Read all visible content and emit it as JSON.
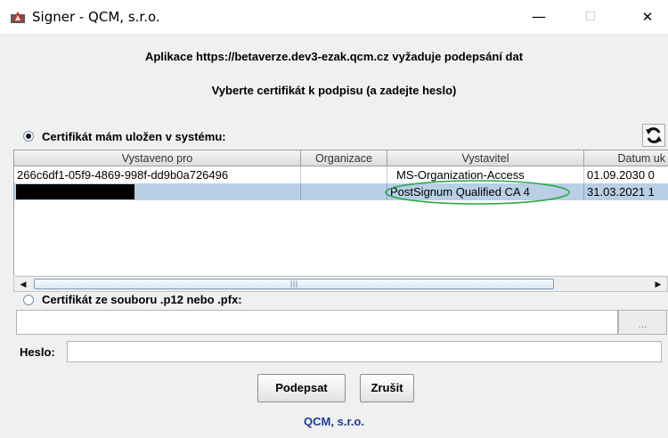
{
  "window": {
    "title": "Signer - QCM, s.r.o.",
    "minimize_glyph": "—",
    "maximize_glyph": "☐",
    "close_glyph": "✕"
  },
  "header": {
    "line1": "Aplikace https://betaverze.dev3-ezak.qcm.cz vyžaduje podepsání dat",
    "line2": "Vyberte certifikát k podpisu (a zadejte heslo)"
  },
  "system_cert": {
    "label": "Certifikát mám uložen v systému:",
    "selected": true
  },
  "table": {
    "columns": [
      "Vystaveno pro",
      "Organizace",
      "Vystavitel",
      "Datum uk"
    ],
    "rows": [
      [
        "266c6df1-05f9-4869-998f-dd9b0a726496",
        "",
        "MS-Organization-Access",
        "01.09.2030 0"
      ],
      [
        "",
        "",
        "PostSignum Qualified CA 4",
        "31.03.2021 1"
      ]
    ],
    "selected_row": 1,
    "redacted_cell": "row 2, Vystaveno pro"
  },
  "file_cert": {
    "label": "Certifikát ze souboru .p12 nebo .pfx:",
    "selected": false,
    "value": "",
    "browse_label": "..."
  },
  "password": {
    "label": "Heslo:",
    "value": ""
  },
  "buttons": {
    "sign": "Podepsat",
    "cancel": "Zrušit"
  },
  "footer": {
    "text": "QCM, s.r.o."
  },
  "colors": {
    "selection": "#b8cfe5",
    "highlight_ellipse": "#2ea84a",
    "footer_link": "#1c3c94"
  },
  "icons": {
    "app": "signer-app-icon",
    "refresh": "refresh-icon",
    "scroll_left": "scroll-left-arrow-icon",
    "scroll_right": "scroll-right-arrow-icon"
  }
}
